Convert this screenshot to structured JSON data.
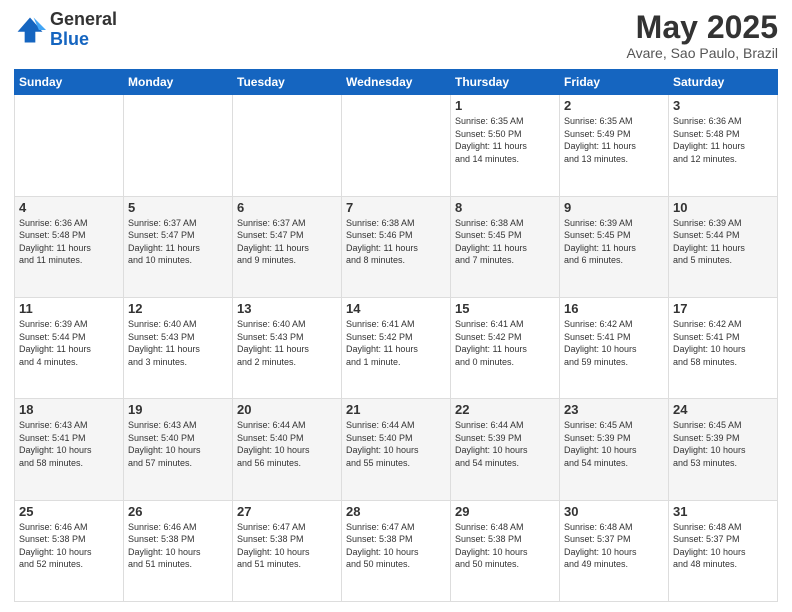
{
  "header": {
    "logo_line1": "General",
    "logo_line2": "Blue",
    "title": "May 2025",
    "subtitle": "Avare, Sao Paulo, Brazil"
  },
  "days_of_week": [
    "Sunday",
    "Monday",
    "Tuesday",
    "Wednesday",
    "Thursday",
    "Friday",
    "Saturday"
  ],
  "weeks": [
    {
      "days": [
        {
          "number": "",
          "info": ""
        },
        {
          "number": "",
          "info": ""
        },
        {
          "number": "",
          "info": ""
        },
        {
          "number": "",
          "info": ""
        },
        {
          "number": "1",
          "info": "Sunrise: 6:35 AM\nSunset: 5:50 PM\nDaylight: 11 hours\nand 14 minutes."
        },
        {
          "number": "2",
          "info": "Sunrise: 6:35 AM\nSunset: 5:49 PM\nDaylight: 11 hours\nand 13 minutes."
        },
        {
          "number": "3",
          "info": "Sunrise: 6:36 AM\nSunset: 5:48 PM\nDaylight: 11 hours\nand 12 minutes."
        }
      ]
    },
    {
      "days": [
        {
          "number": "4",
          "info": "Sunrise: 6:36 AM\nSunset: 5:48 PM\nDaylight: 11 hours\nand 11 minutes."
        },
        {
          "number": "5",
          "info": "Sunrise: 6:37 AM\nSunset: 5:47 PM\nDaylight: 11 hours\nand 10 minutes."
        },
        {
          "number": "6",
          "info": "Sunrise: 6:37 AM\nSunset: 5:47 PM\nDaylight: 11 hours\nand 9 minutes."
        },
        {
          "number": "7",
          "info": "Sunrise: 6:38 AM\nSunset: 5:46 PM\nDaylight: 11 hours\nand 8 minutes."
        },
        {
          "number": "8",
          "info": "Sunrise: 6:38 AM\nSunset: 5:45 PM\nDaylight: 11 hours\nand 7 minutes."
        },
        {
          "number": "9",
          "info": "Sunrise: 6:39 AM\nSunset: 5:45 PM\nDaylight: 11 hours\nand 6 minutes."
        },
        {
          "number": "10",
          "info": "Sunrise: 6:39 AM\nSunset: 5:44 PM\nDaylight: 11 hours\nand 5 minutes."
        }
      ]
    },
    {
      "days": [
        {
          "number": "11",
          "info": "Sunrise: 6:39 AM\nSunset: 5:44 PM\nDaylight: 11 hours\nand 4 minutes."
        },
        {
          "number": "12",
          "info": "Sunrise: 6:40 AM\nSunset: 5:43 PM\nDaylight: 11 hours\nand 3 minutes."
        },
        {
          "number": "13",
          "info": "Sunrise: 6:40 AM\nSunset: 5:43 PM\nDaylight: 11 hours\nand 2 minutes."
        },
        {
          "number": "14",
          "info": "Sunrise: 6:41 AM\nSunset: 5:42 PM\nDaylight: 11 hours\nand 1 minute."
        },
        {
          "number": "15",
          "info": "Sunrise: 6:41 AM\nSunset: 5:42 PM\nDaylight: 11 hours\nand 0 minutes."
        },
        {
          "number": "16",
          "info": "Sunrise: 6:42 AM\nSunset: 5:41 PM\nDaylight: 10 hours\nand 59 minutes."
        },
        {
          "number": "17",
          "info": "Sunrise: 6:42 AM\nSunset: 5:41 PM\nDaylight: 10 hours\nand 58 minutes."
        }
      ]
    },
    {
      "days": [
        {
          "number": "18",
          "info": "Sunrise: 6:43 AM\nSunset: 5:41 PM\nDaylight: 10 hours\nand 58 minutes."
        },
        {
          "number": "19",
          "info": "Sunrise: 6:43 AM\nSunset: 5:40 PM\nDaylight: 10 hours\nand 57 minutes."
        },
        {
          "number": "20",
          "info": "Sunrise: 6:44 AM\nSunset: 5:40 PM\nDaylight: 10 hours\nand 56 minutes."
        },
        {
          "number": "21",
          "info": "Sunrise: 6:44 AM\nSunset: 5:40 PM\nDaylight: 10 hours\nand 55 minutes."
        },
        {
          "number": "22",
          "info": "Sunrise: 6:44 AM\nSunset: 5:39 PM\nDaylight: 10 hours\nand 54 minutes."
        },
        {
          "number": "23",
          "info": "Sunrise: 6:45 AM\nSunset: 5:39 PM\nDaylight: 10 hours\nand 54 minutes."
        },
        {
          "number": "24",
          "info": "Sunrise: 6:45 AM\nSunset: 5:39 PM\nDaylight: 10 hours\nand 53 minutes."
        }
      ]
    },
    {
      "days": [
        {
          "number": "25",
          "info": "Sunrise: 6:46 AM\nSunset: 5:38 PM\nDaylight: 10 hours\nand 52 minutes."
        },
        {
          "number": "26",
          "info": "Sunrise: 6:46 AM\nSunset: 5:38 PM\nDaylight: 10 hours\nand 51 minutes."
        },
        {
          "number": "27",
          "info": "Sunrise: 6:47 AM\nSunset: 5:38 PM\nDaylight: 10 hours\nand 51 minutes."
        },
        {
          "number": "28",
          "info": "Sunrise: 6:47 AM\nSunset: 5:38 PM\nDaylight: 10 hours\nand 50 minutes."
        },
        {
          "number": "29",
          "info": "Sunrise: 6:48 AM\nSunset: 5:38 PM\nDaylight: 10 hours\nand 50 minutes."
        },
        {
          "number": "30",
          "info": "Sunrise: 6:48 AM\nSunset: 5:37 PM\nDaylight: 10 hours\nand 49 minutes."
        },
        {
          "number": "31",
          "info": "Sunrise: 6:48 AM\nSunset: 5:37 PM\nDaylight: 10 hours\nand 48 minutes."
        }
      ]
    }
  ]
}
